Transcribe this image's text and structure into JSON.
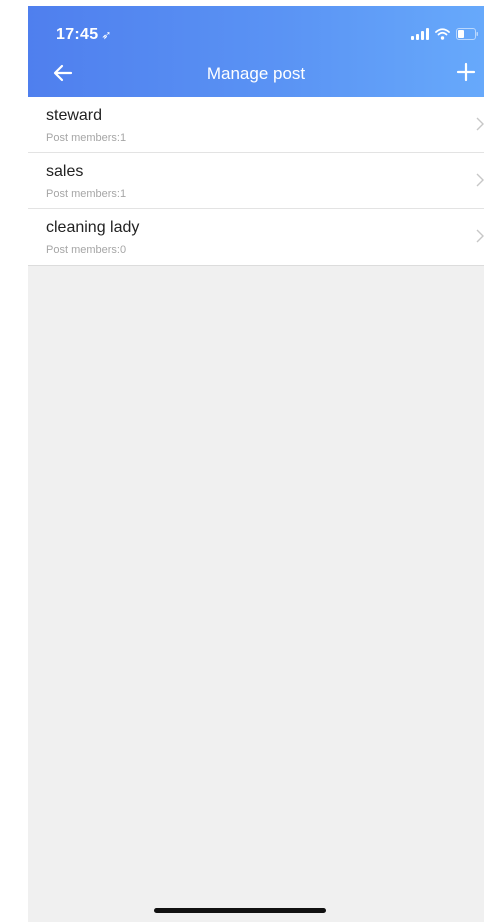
{
  "status_bar": {
    "time": "17:45",
    "location_glyph": "➶",
    "icons": [
      "signal-icon",
      "wifi-icon",
      "battery-icon"
    ]
  },
  "nav": {
    "title": "Manage post",
    "back_icon": "arrow-left-icon",
    "add_icon": "plus-icon"
  },
  "posts": [
    {
      "name": "steward",
      "members": "Post members:1"
    },
    {
      "name": "sales",
      "members": "Post members:1"
    },
    {
      "name": "cleaning lady",
      "members": "Post members:0"
    }
  ],
  "colors": {
    "header_start": "#4f7fee",
    "header_end": "#67a9fb",
    "background": "#f0f0f0",
    "list_background": "#ffffff",
    "secondary_text": "#a6a6a6"
  }
}
